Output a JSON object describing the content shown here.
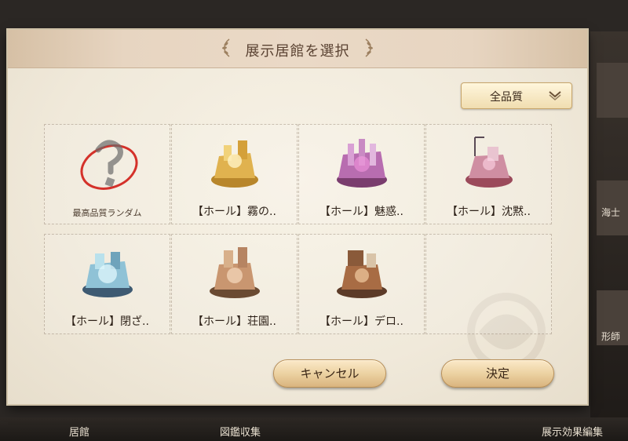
{
  "dialog": {
    "title": "展示居館を選択",
    "quality_filter": {
      "selected": "全品質"
    },
    "items": [
      {
        "label": "最高品質ランダム",
        "icon": "question-mark-icon",
        "random": true
      },
      {
        "label": "【ホール】霧の..",
        "icon": "golden-hall-icon"
      },
      {
        "label": "【ホール】魅惑..",
        "icon": "purple-hall-icon"
      },
      {
        "label": "【ホール】沈黙..",
        "icon": "pink-hall-icon"
      },
      {
        "label": "【ホール】閉ざ..",
        "icon": "blue-hall-icon"
      },
      {
        "label": "【ホール】荘園..",
        "icon": "manor-hall-icon"
      },
      {
        "label": "【ホール】デロ..",
        "icon": "brown-hall-icon"
      }
    ],
    "cancel_label": "キャンセル",
    "confirm_label": "決定"
  },
  "background": {
    "right_labels": [
      "海士",
      "形師"
    ],
    "bottom_labels": [
      "居館",
      "図鑑収集",
      "展示効果編集"
    ]
  }
}
